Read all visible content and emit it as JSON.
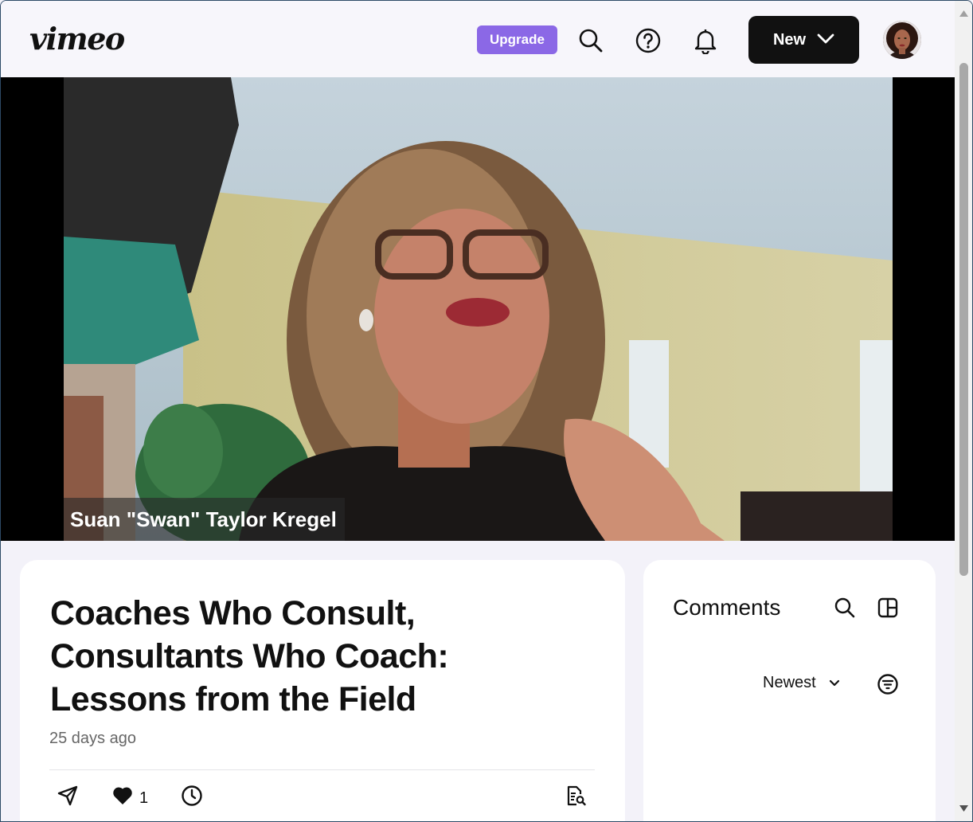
{
  "header": {
    "logo_text": "vimeo",
    "upgrade_label": "Upgrade",
    "new_label": "New"
  },
  "video": {
    "caption": "Suan \"Swan\" Taylor Kregel"
  },
  "details": {
    "title": "Coaches Who Consult, Consultants Who Coach: Lessons from the Field",
    "age": "25 days ago",
    "like_count": "1"
  },
  "comments": {
    "heading": "Comments",
    "sort_label": "Newest"
  },
  "colors": {
    "upgrade_bg": "#8b68e6",
    "new_bg": "#111111",
    "page_bg": "#f3f2f9"
  },
  "icons": {
    "search": "search-icon",
    "help": "help-icon",
    "notifications": "bell-icon",
    "share": "send-icon",
    "like": "heart-icon",
    "watch_later": "clock-icon",
    "transcript": "transcript-search-icon",
    "layout": "layout-panel-icon",
    "filter": "filter-icon"
  }
}
